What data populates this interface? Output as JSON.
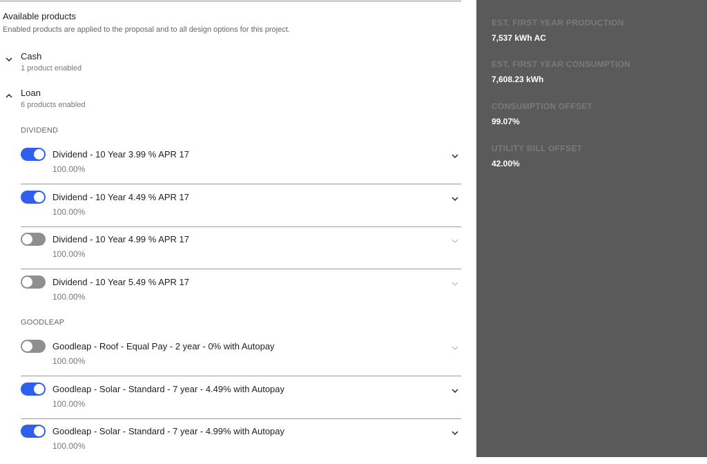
{
  "header": {
    "title": "Available products",
    "subtitle": "Enabled products are applied to the proposal and to all design options for this project."
  },
  "groups": [
    {
      "title": "Cash",
      "subtitle": "1 product enabled",
      "expanded": false
    },
    {
      "title": "Loan",
      "subtitle": "6 products enabled",
      "expanded": true
    }
  ],
  "sections": {
    "dividend": {
      "label": "DIVIDEND",
      "products": [
        {
          "title": "Dividend - 10 Year 3.99 % APR 17",
          "percent": "100.00%",
          "enabled": true
        },
        {
          "title": "Dividend - 10 Year 4.49 % APR 17",
          "percent": "100.00%",
          "enabled": true
        },
        {
          "title": "Dividend - 10 Year 4.99 % APR 17",
          "percent": "100.00%",
          "enabled": false
        },
        {
          "title": "Dividend - 10 Year 5.49 % APR 17",
          "percent": "100.00%",
          "enabled": false
        }
      ]
    },
    "goodleap": {
      "label": "GOODLEAP",
      "products": [
        {
          "title": "Goodleap - Roof - Equal Pay - 2 year - 0% with Autopay",
          "percent": "100.00%",
          "enabled": false
        },
        {
          "title": "Goodleap - Solar - Standard - 7 year - 4.49% with Autopay",
          "percent": "100.00%",
          "enabled": true
        },
        {
          "title": "Goodleap - Solar - Standard - 7 year - 4.99% with Autopay",
          "percent": "100.00%",
          "enabled": true
        }
      ]
    }
  },
  "stats": [
    {
      "label": "EST. FIRST YEAR PRODUCTION",
      "value": "7,537 kWh AC"
    },
    {
      "label": "EST. FIRST YEAR CONSUMPTION",
      "value": "7,608.23 kWh"
    },
    {
      "label": "CONSUMPTION OFFSET",
      "value": "99.07%"
    },
    {
      "label": "UTILITY BILL OFFSET",
      "value": "42.00%"
    }
  ],
  "colors": {
    "toggle_on": "#2f5fec",
    "toggle_off": "#8f8f8f",
    "sidebar_bg": "#5a5a5a"
  },
  "icons": {
    "collapsed": "chevron-down-icon",
    "expanded": "chevron-up-icon",
    "row_expand": "chevron-down-icon"
  }
}
